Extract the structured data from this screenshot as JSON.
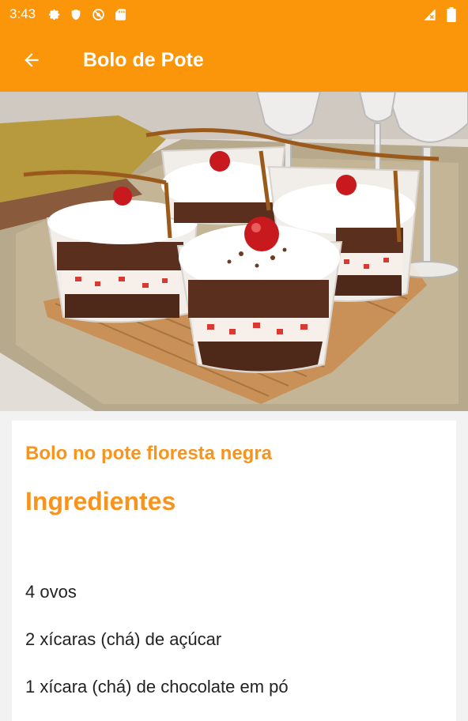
{
  "status_bar": {
    "time": "3:43",
    "left_icons": [
      "gear-icon",
      "shield-icon",
      "no-signal-icon",
      "sd-card-icon"
    ],
    "right_icons": [
      "cell-signal-icon",
      "battery-icon"
    ]
  },
  "app_bar": {
    "title": "Bolo de Pote",
    "back_icon": "arrow-back-icon"
  },
  "colors": {
    "primary": "#fb9509",
    "accent_text": "#f7941e",
    "body_text": "#222222"
  },
  "recipe": {
    "name": "Bolo no pote floresta negra",
    "ingredients_heading": "Ingredientes",
    "ingredients": [
      "4 ovos",
      "2 xícaras (chá) de açúcar",
      "1 xícara (chá) de chocolate em pó"
    ]
  }
}
